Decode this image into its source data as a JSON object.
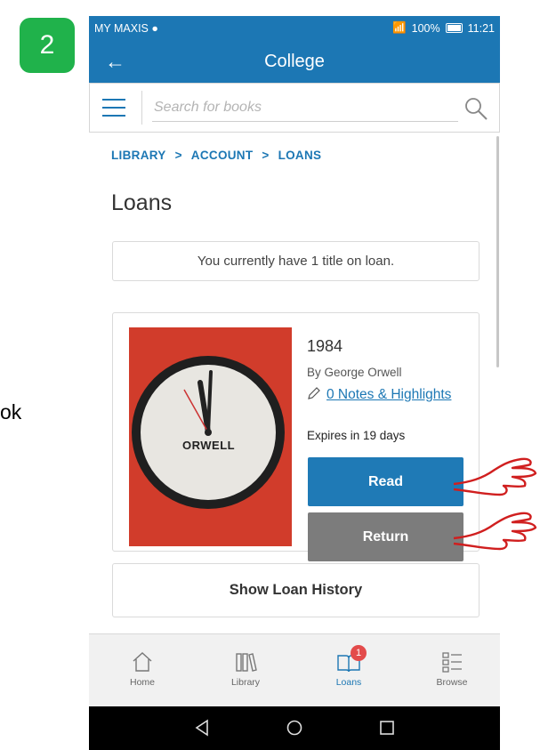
{
  "tutorial": {
    "step_number": "2",
    "side_text": "ok"
  },
  "status_bar": {
    "carrier": "MY MAXIS ●",
    "battery": "100%",
    "time": "11:21"
  },
  "app_bar": {
    "title": "College"
  },
  "search": {
    "placeholder": "Search for books",
    "value": ""
  },
  "breadcrumb": [
    {
      "label": "LIBRARY"
    },
    {
      "label": "ACCOUNT"
    },
    {
      "label": "LOANS"
    }
  ],
  "breadcrumb_separator": ">",
  "page": {
    "title": "Loans",
    "loan_count_message": "You currently have 1 title on loan."
  },
  "loan": {
    "cover_text": "ORWELL",
    "title": "1984",
    "author": "By George Orwell",
    "notes_link": "0 Notes & Highlights",
    "expires": "Expires in 19 days",
    "read_label": "Read",
    "return_label": "Return"
  },
  "history_button": "Show Loan History",
  "bottom_nav": {
    "items": [
      {
        "label": "Home",
        "icon": "home-icon"
      },
      {
        "label": "Library",
        "icon": "library-icon"
      },
      {
        "label": "Loans",
        "icon": "loans-icon",
        "badge": "1",
        "active": true
      },
      {
        "label": "Browse",
        "icon": "browse-icon"
      }
    ]
  },
  "colors": {
    "primary": "#1c77b4",
    "read_button": "#1f7ab6",
    "return_button": "#7c7c7c",
    "step_badge": "#20b24b",
    "notification_badge": "#e34b4b",
    "cover": "#d13c2b"
  }
}
